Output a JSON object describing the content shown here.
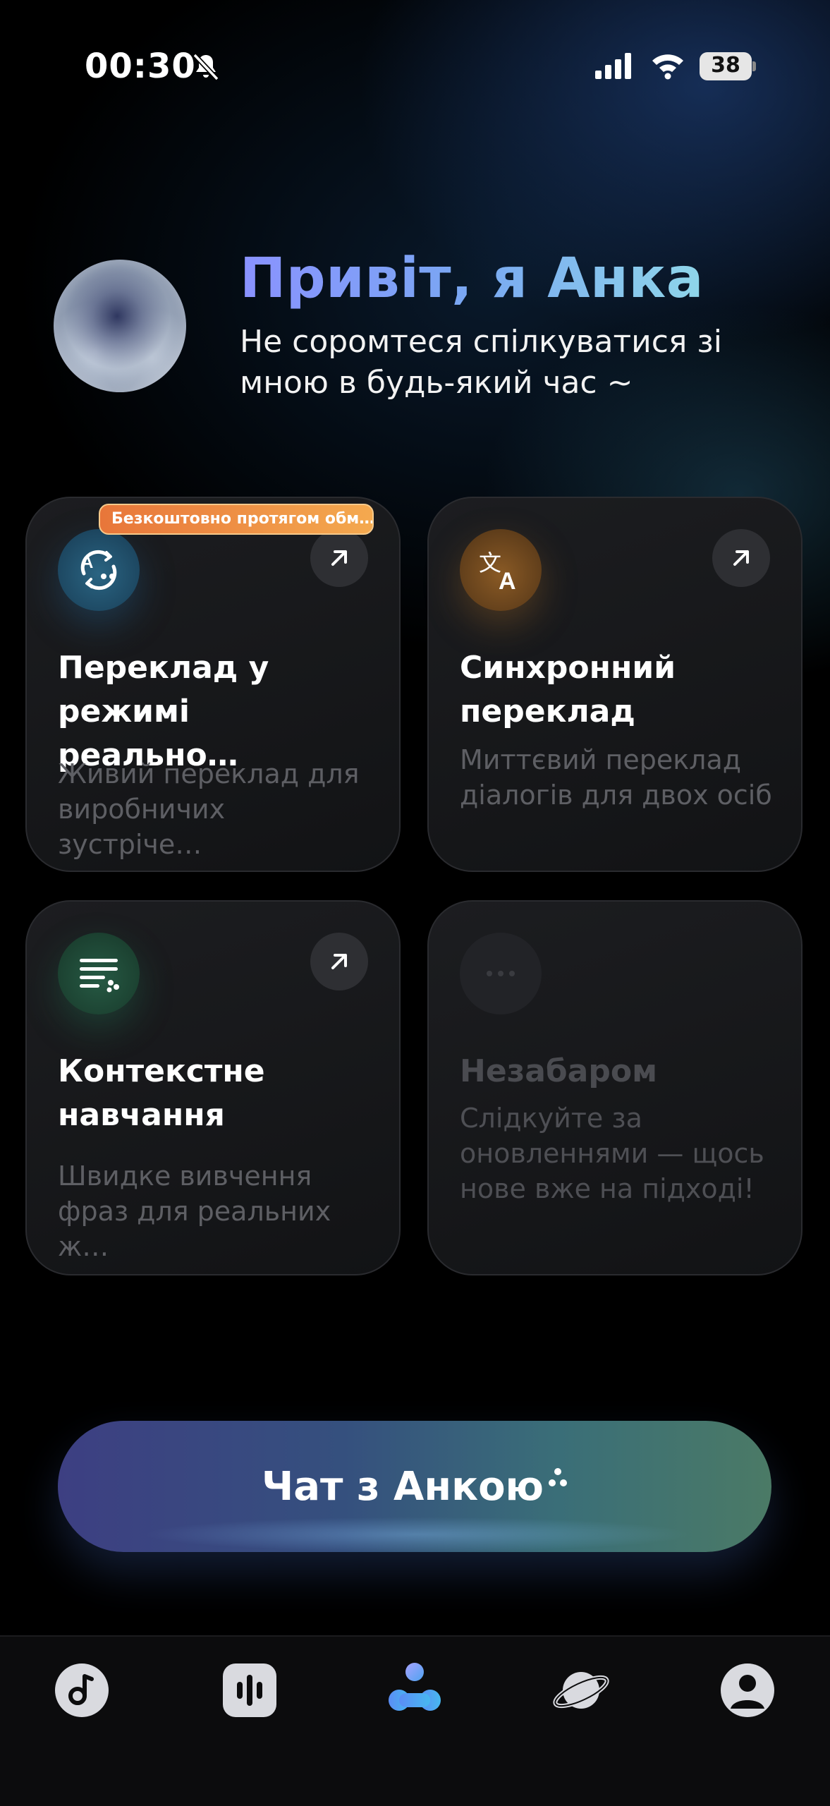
{
  "status_bar": {
    "time": "00:30",
    "battery": "38",
    "icons": [
      "bell-slash-icon",
      "signal-icon",
      "wifi-icon",
      "battery-icon"
    ]
  },
  "header": {
    "greeting": "Привіт, я Анка",
    "subtitle": "Не соромтеся спілкуватися зі мною в будь-який час ~"
  },
  "cards": [
    {
      "title": "Переклад у режимі реально…",
      "description": "Живий переклад для виробничих зустріче…",
      "badge": "Безкоштовно протягом обм…",
      "icon": "realtime-translate-icon",
      "accent": "#1f4e6e"
    },
    {
      "title": "Синхронний переклад",
      "description": "Миттєвий переклад діалогів для двох осіб",
      "icon": "translate-language-icon",
      "accent": "#7a4d1f"
    },
    {
      "title": "Контекстне навчання",
      "description": "Швидке вивчення фраз для реальних ж…",
      "icon": "context-learning-icon",
      "accent": "#1f4a3a"
    },
    {
      "title": "Незабаром",
      "description": "Слідкуйте за оновленнями — щось нове вже на підході!",
      "icon": "more-dots-icon",
      "accent": "#1e1f22"
    }
  ],
  "chat_button": {
    "label": "Чат з Анкою"
  },
  "tab_bar": {
    "items": [
      {
        "name": "music",
        "icon": "music-note-icon"
      },
      {
        "name": "voice",
        "icon": "audio-bars-icon"
      },
      {
        "name": "anka",
        "icon": "anka-assistant-icon",
        "active": true
      },
      {
        "name": "explore",
        "icon": "planet-icon"
      },
      {
        "name": "profile",
        "icon": "profile-icon"
      }
    ]
  },
  "colors": {
    "background": "#000000",
    "greeting_gradient_start": "#8a92ff",
    "greeting_gradient_end": "#8fd6ea",
    "badge": "#f08a3e",
    "card_bg": "#17181b",
    "active_tab": "#5aa4f0"
  }
}
